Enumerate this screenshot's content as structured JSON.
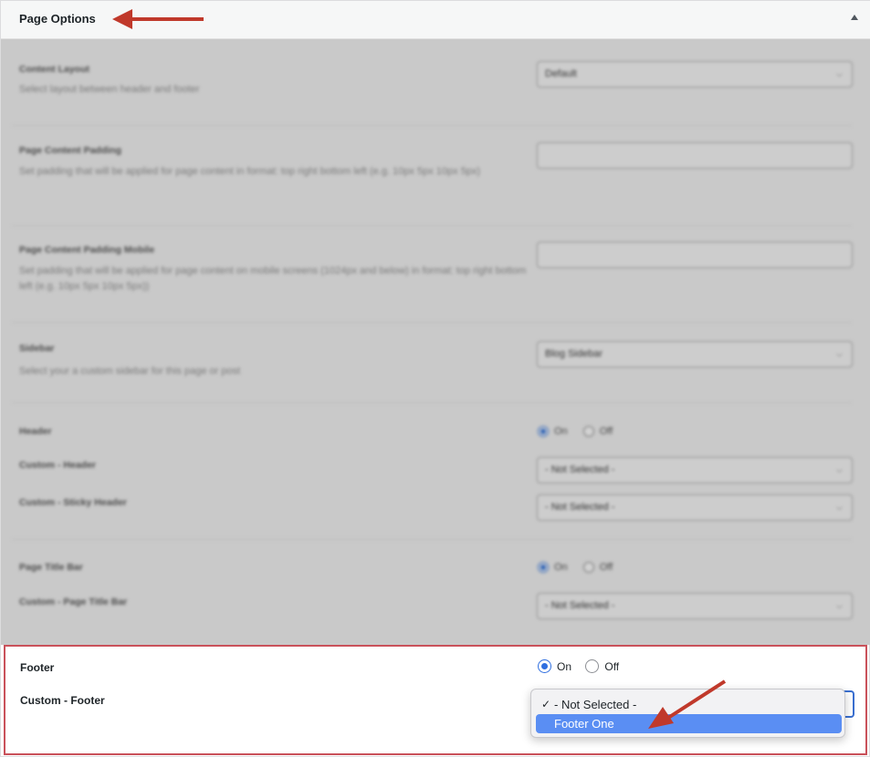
{
  "panel": {
    "title": "Page Options",
    "collapse_icon": "triangle-up-icon",
    "annotation_color": "#c0392b"
  },
  "rows": {
    "content_layout": {
      "label": "Content Layout",
      "desc": "Select layout between header and footer",
      "value": "Default"
    },
    "content_padding": {
      "label": "Page Content Padding",
      "desc": "Set padding that will be applied for page content in format: top right bottom left (e.g. 10px 5px 10px 5px)",
      "value": ""
    },
    "content_padding_mobile": {
      "label": "Page Content Padding Mobile",
      "desc": "Set padding that will be applied for page content on mobile screens (1024px and below) in format: top right bottom left (e.g. 10px 5px 10px 5px))",
      "value": ""
    },
    "sidebar": {
      "label": "Sidebar",
      "desc": "Select your a custom sidebar for this page or post",
      "value": "Blog Sidebar"
    },
    "header": {
      "label": "Header",
      "on": "On",
      "off": "Off",
      "custom_header_label": "Custom - Header",
      "custom_header_value": "- Not Selected -",
      "custom_sticky_label": "Custom - Sticky Header",
      "custom_sticky_value": "- Not Selected -"
    },
    "title_bar": {
      "label": "Page Title Bar",
      "on": "On",
      "off": "Off",
      "custom_label": "Custom - Page Title Bar",
      "custom_value": "- Not Selected -"
    }
  },
  "footer": {
    "label": "Footer",
    "on": "On",
    "off": "Off",
    "selected": "On",
    "custom_label": "Custom - Footer",
    "dropdown_options": [
      {
        "label": "- Not Selected -",
        "checked": true
      },
      {
        "label": "Footer One",
        "checked": false
      }
    ],
    "check_mark": "✓"
  }
}
